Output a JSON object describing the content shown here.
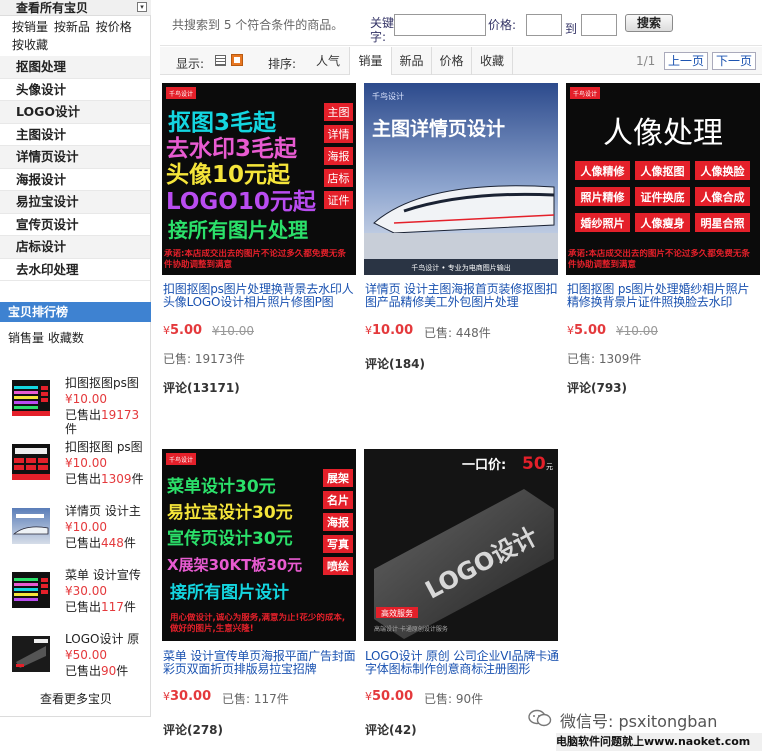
{
  "sidebar": {
    "header": "查看所有宝贝",
    "sub_links": [
      "按销量",
      "按新品",
      "按价格",
      "按收藏"
    ],
    "categories": [
      "抠图处理",
      "头像设计",
      "LOGO设计",
      "主图设计",
      "详情页设计",
      "海报设计",
      "易拉宝设计",
      "宣传页设计",
      "店标设计",
      "去水印处理"
    ],
    "ranking": {
      "title": "宝贝排行榜",
      "tabs": [
        "销售量",
        "收藏数"
      ],
      "items": [
        {
          "title": "扣图抠图ps图",
          "price": "¥10.00",
          "sold_label": "已售出",
          "sold": "19173",
          "unit": "件"
        },
        {
          "title": "扣图抠图 ps图",
          "price": "¥10.00",
          "sold_label": "已售出",
          "sold": "1309",
          "unit": "件"
        },
        {
          "title": "详情页 设计主",
          "price": "¥10.00",
          "sold_label": "已售出",
          "sold": "448",
          "unit": "件"
        },
        {
          "title": "菜单 设计宣传",
          "price": "¥30.00",
          "sold_label": "已售出",
          "sold": "117",
          "unit": "件"
        },
        {
          "title": "LOGO设计 原",
          "price": "¥50.00",
          "sold_label": "已售出",
          "sold": "90",
          "unit": "件"
        }
      ],
      "more": "查看更多宝贝"
    }
  },
  "search": {
    "summary": "共搜索到 5 个符合条件的商品。",
    "keyword_label": "关键字:",
    "keyword_value": "",
    "price_label": "价格:",
    "to_label": "到",
    "button": "搜索"
  },
  "toolbar": {
    "display_label": "显示:",
    "sort_label": "排序:",
    "sort_tabs": [
      "人气",
      "销量",
      "新品",
      "价格",
      "收藏"
    ],
    "page_indicator": "1/1",
    "prev": "上一页",
    "next": "下一页"
  },
  "products": [
    {
      "title": "扣图抠图ps图片处理换背景去水印人头像LOGO设计相片照片修图P图",
      "price": "5.00",
      "currency": "¥",
      "orig_price": "¥10.00",
      "sold": "已售: 19173件",
      "reviews": "评论(13171)",
      "img": {
        "badge": "千鸟设计",
        "lines": [
          "抠图3毛起",
          "去水印3毛起",
          "头像10元起",
          "LOGO10元起",
          "接所有图片处理"
        ],
        "tags": [
          "主图",
          "详情",
          "海报",
          "店标",
          "证件"
        ],
        "footer": "承诺:本店成交出去的图片不论过多久都免费无条件协助调整到满意"
      }
    },
    {
      "title": "详情页 设计主图海报首页装修抠图扣图产品精修美工外包图片处理",
      "price": "10.00",
      "currency": "¥",
      "orig_price": "",
      "sold": "已售: 448件",
      "reviews": "评论(184)",
      "img": {
        "headline": "主图详情页设计",
        "topline": "千鸟设计",
        "footer": "千鸟设计 • 专业为电商图片输出"
      }
    },
    {
      "title": "扣图抠图 ps图片处理婚纱相片照片精修换背景片证件照换脸去水印",
      "price": "5.00",
      "currency": "¥",
      "orig_price": "¥10.00",
      "sold": "已售: 1309件",
      "reviews": "评论(793)",
      "img": {
        "badge": "千鸟设计",
        "headline": "人像处理",
        "tags": [
          "人像精修",
          "人像抠图",
          "人像换脸",
          "照片精修",
          "证件换底",
          "人像合成",
          "婚纱照片",
          "人像瘦身",
          "明星合照"
        ],
        "footer": "承诺:本店成交出去的图片不论过多久都免费无条件协助调整到满意"
      }
    },
    {
      "title": "菜单 设计宣传单页海报平面广告封面彩页双面折页排版易拉宝招牌",
      "price": "30.00",
      "currency": "¥",
      "orig_price": "",
      "sold": "已售: 117件",
      "reviews": "评论(278)",
      "img": {
        "badge": "千鸟设计",
        "lines": [
          "菜单设计30元",
          "易拉宝设计30元",
          "宣传页设计30元",
          "X展架30KT板30元",
          "接所有图片设计"
        ],
        "tags": [
          "展架",
          "名片",
          "海报",
          "写真",
          "喷绘"
        ],
        "footer": "用心做设计,诚心为服务,满意为止!花少的成本,做好的图片,生意兴隆!"
      }
    },
    {
      "title": "LOGO设计 原创 公司企业VI品牌卡通字体图标制作创意商标注册图形",
      "price": "50.00",
      "currency": "¥",
      "orig_price": "",
      "sold": "已售: 90件",
      "reviews": "评论(42)",
      "img": {
        "price_tag": "一口价:",
        "price_value": "50",
        "price_unit": "元",
        "logo_text": "LOGO设计",
        "service": "高效服务",
        "footer": "高端设计·卡通原创设计服务"
      }
    }
  ],
  "watermark": {
    "text": "微信号: psxitongban",
    "bar": "电脑软件问题就上www.naoket.com"
  },
  "colors": {
    "link": "#1a52b0",
    "price": "#e4393c",
    "rank_header": "#3e82d1"
  }
}
